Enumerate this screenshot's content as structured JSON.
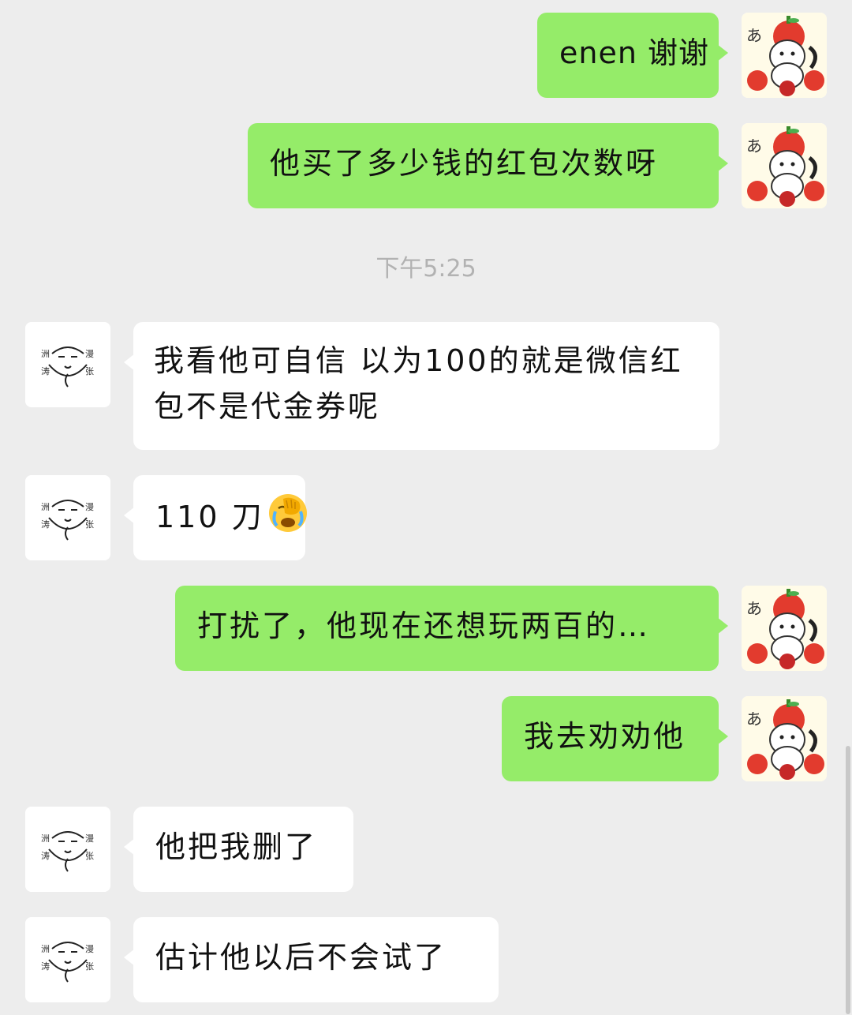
{
  "timestamp": "下午5:25",
  "messages": [
    {
      "side": "out",
      "text": "enen 谢谢"
    },
    {
      "side": "out",
      "text": "他买了多少钱的红包次数呀"
    },
    {
      "side": "in",
      "text": "我看他可自信  以为100的就是微信红包不是代金券呢"
    },
    {
      "side": "in",
      "text": "110 刀",
      "emoji": "face-palm-crying-emoji"
    },
    {
      "side": "out",
      "text": "打扰了，他现在还想玩两百的…"
    },
    {
      "side": "out",
      "text": "我去劝劝他"
    },
    {
      "side": "in",
      "text": "他把我删了"
    },
    {
      "side": "in",
      "text": "估计他以后不会试了"
    }
  ],
  "avatars": {
    "self": "apple-hat-cat-avatar",
    "contact": "doodle-face-avatar"
  },
  "colors": {
    "background": "#ededed",
    "outgoing_bubble": "#95ec69",
    "incoming_bubble": "#ffffff",
    "timestamp": "#b2b2b2"
  }
}
